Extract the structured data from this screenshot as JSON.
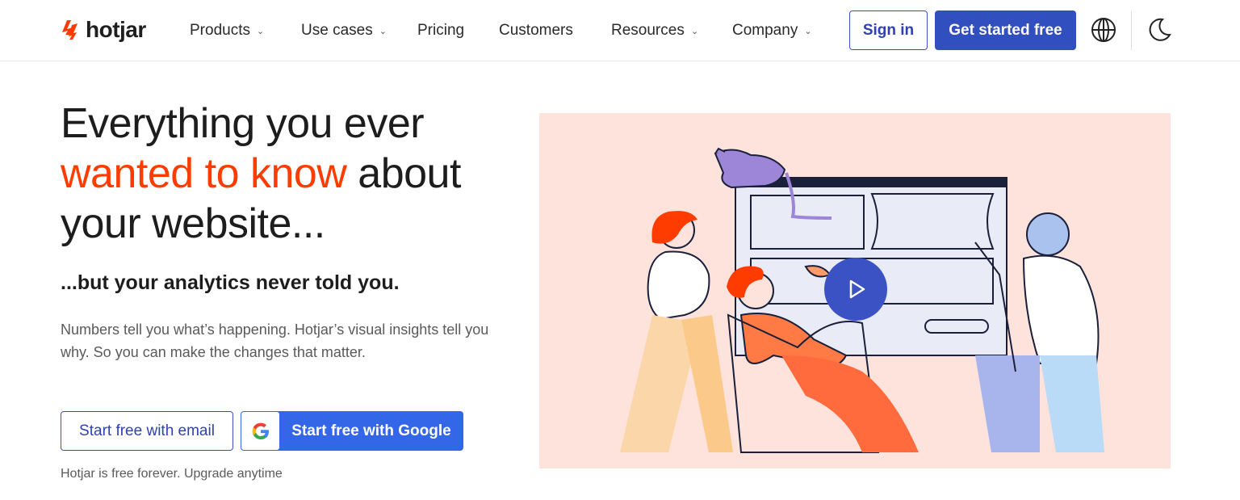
{
  "brand": {
    "name": "hotjar",
    "accent": "#ff3c00",
    "primary": "#324fbf"
  },
  "nav": {
    "items": [
      {
        "label": "Products",
        "has_menu": true
      },
      {
        "label": "Use cases",
        "has_menu": true
      },
      {
        "label": "Pricing",
        "has_menu": false
      },
      {
        "label": "Customers",
        "has_menu": false
      },
      {
        "label": "Resources",
        "has_menu": true
      },
      {
        "label": "Company",
        "has_menu": true
      }
    ],
    "sign_in": "Sign in",
    "get_started": "Get started free",
    "icons": {
      "language": "globe-icon",
      "theme": "moon-icon",
      "menu": "chevron-down-icon"
    }
  },
  "hero": {
    "title_line1": "Everything you ever",
    "title_accent": "wanted to know",
    "title_after_accent": " about",
    "title_line3": "your website...",
    "subtitle": "...but your analytics never told you.",
    "description": "Numbers tell you what’s happening. Hotjar’s visual insights tell you why. So you can make the changes that matter.",
    "cta_email": "Start free with email",
    "cta_google": "Start free with Google",
    "note": "Hotjar is free forever. Upgrade anytime"
  },
  "media": {
    "play_icon": "play-icon",
    "background": "#fde3db"
  }
}
